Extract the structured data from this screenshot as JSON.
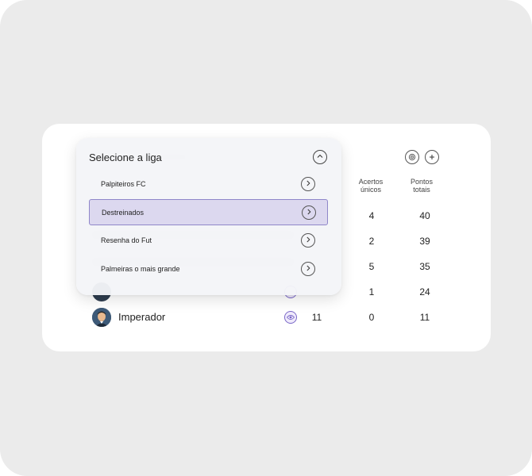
{
  "dropdown": {
    "title": "Selecione a liga",
    "items": [
      {
        "label": "Palpiteiros FC",
        "selected": false
      },
      {
        "label": "Destreinados",
        "selected": true
      },
      {
        "label": "Resenha do Fut",
        "selected": false
      },
      {
        "label": "Palmeiras o mais grande",
        "selected": false
      }
    ]
  },
  "table": {
    "headers": {
      "acertos_unicos_1": "Acertos",
      "acertos_unicos_2": "únicos",
      "pontos_totais_1": "Pontos",
      "pontos_totais_2": "totais"
    },
    "rows": [
      {
        "name": "",
        "acertos": "",
        "unicos": "4",
        "pontos": "40"
      },
      {
        "name": "",
        "acertos": "",
        "unicos": "2",
        "pontos": "39"
      },
      {
        "name": "",
        "acertos": "",
        "unicos": "5",
        "pontos": "35"
      },
      {
        "name": "",
        "acertos": "",
        "unicos": "1",
        "pontos": "24"
      },
      {
        "name": "Imperador",
        "acertos": "11",
        "unicos": "0",
        "pontos": "11"
      }
    ]
  },
  "icons": {
    "settings": "gear-icon",
    "add": "plus-icon",
    "view": "eye-icon",
    "collapse": "chevron-up-icon",
    "go": "chevron-right-icon"
  },
  "colors": {
    "accent": "#7a68c8",
    "selected_bg": "#dcd8ef",
    "background": "#ebebeb"
  }
}
